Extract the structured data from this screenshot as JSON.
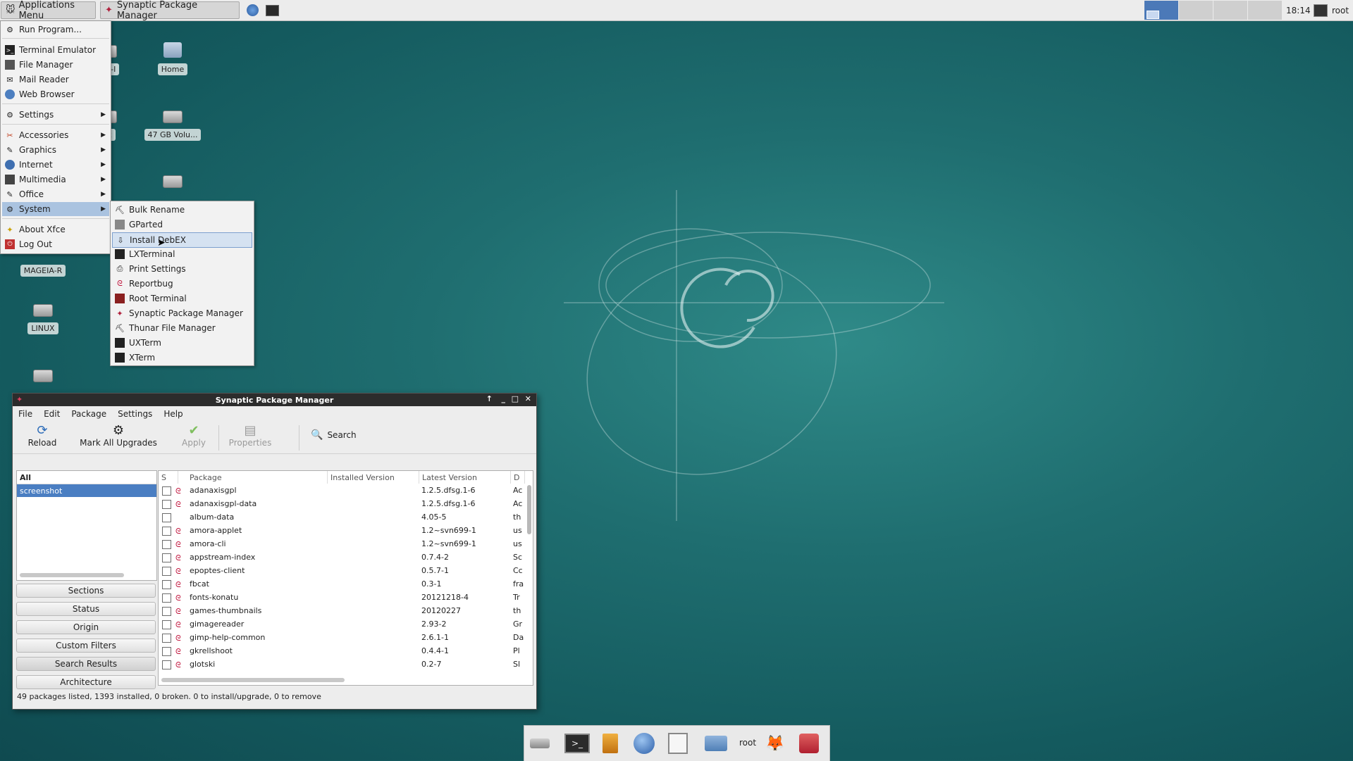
{
  "top_panel": {
    "apps_menu": "Applications Menu",
    "task": "Synaptic Package Manager",
    "clock": "18:14",
    "user": "root"
  },
  "desktop": {
    "icons": [
      "EIA-I",
      "Home",
      "X2",
      "47 GB Volu...",
      "MAGEIA-R",
      "LINUX"
    ]
  },
  "app_menu": {
    "items": [
      "Run Program...",
      "Terminal Emulator",
      "File Manager",
      "Mail Reader",
      "Web Browser",
      "Settings",
      "Accessories",
      "Graphics",
      "Internet",
      "Multimedia",
      "Office",
      "System",
      "About Xfce",
      "Log Out"
    ]
  },
  "system_menu": {
    "items": [
      "Bulk Rename",
      "GParted",
      "Install DebEX",
      "LXTerminal",
      "Print Settings",
      "Reportbug",
      "Root Terminal",
      "Synaptic Package Manager",
      "Thunar File Manager",
      "UXTerm",
      "XTerm"
    ]
  },
  "synaptic": {
    "title": "Synaptic Package Manager",
    "menus": [
      "File",
      "Edit",
      "Package",
      "Settings",
      "Help"
    ],
    "toolbar": [
      "Reload",
      "Mark All Upgrades",
      "Apply",
      "Properties",
      "Search"
    ],
    "filters": [
      "All",
      "screenshot"
    ],
    "side_buttons": [
      "Sections",
      "Status",
      "Origin",
      "Custom Filters",
      "Search Results",
      "Architecture"
    ],
    "columns": [
      "S",
      "Package",
      "Installed Version",
      "Latest Version",
      "D"
    ],
    "packages": [
      {
        "name": "adanaxisgpl",
        "latest": "1.2.5.dfsg.1-6",
        "desc": "Ac"
      },
      {
        "name": "adanaxisgpl-data",
        "latest": "1.2.5.dfsg.1-6",
        "desc": "Ac"
      },
      {
        "name": "album-data",
        "latest": "4.05-5",
        "desc": "th"
      },
      {
        "name": "amora-applet",
        "latest": "1.2~svn699-1",
        "desc": "us"
      },
      {
        "name": "amora-cli",
        "latest": "1.2~svn699-1",
        "desc": "us"
      },
      {
        "name": "appstream-index",
        "latest": "0.7.4-2",
        "desc": "Sc"
      },
      {
        "name": "epoptes-client",
        "latest": "0.5.7-1",
        "desc": "Cc"
      },
      {
        "name": "fbcat",
        "latest": "0.3-1",
        "desc": "fra"
      },
      {
        "name": "fonts-konatu",
        "latest": "20121218-4",
        "desc": "Tr"
      },
      {
        "name": "games-thumbnails",
        "latest": "20120227",
        "desc": "th"
      },
      {
        "name": "gimagereader",
        "latest": "2.93-2",
        "desc": "Gr"
      },
      {
        "name": "gimp-help-common",
        "latest": "2.6.1-1",
        "desc": "Da"
      },
      {
        "name": "gkrellshoot",
        "latest": "0.4.4-1",
        "desc": "Pl"
      },
      {
        "name": "glotski",
        "latest": "0.2-7",
        "desc": "Sl"
      }
    ],
    "status": "49 packages listed, 1393 installed, 0 broken. 0 to install/upgrade, 0 to remove"
  },
  "dock": {
    "label": "root"
  }
}
